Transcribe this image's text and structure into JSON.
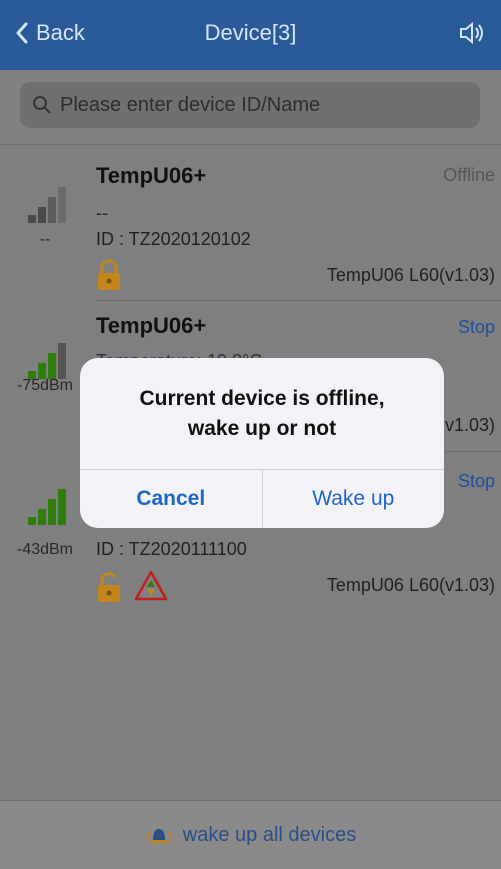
{
  "nav": {
    "back_label": "Back",
    "title": "Device[3]",
    "speaker_icon": "speaker-icon"
  },
  "search": {
    "placeholder": "Please enter device ID/Name"
  },
  "devices": [
    {
      "name": "TempU06+",
      "status": "Offline",
      "line2": "--",
      "id": "ID : TZ2020120102",
      "signal": "--",
      "version": "TempU06 L60(v1.03)",
      "locked": true
    },
    {
      "name": "TempU06+",
      "status": "Stop",
      "line2": "Temperature: 19.8°C",
      "signal": "-75dBm",
      "version": "v1.03)"
    },
    {
      "name": "",
      "status": "Stop",
      "id": "ID : TZ2020111100",
      "signal": "-43dBm",
      "version": "TempU06 L60(v1.03)",
      "locked": false,
      "warning": true
    }
  ],
  "dialog": {
    "message_line1": "Current device is offline,",
    "message_line2": "wake up or not",
    "cancel": "Cancel",
    "wake": "Wake up"
  },
  "bottom": {
    "wake_all": "wake up all devices"
  },
  "colors": {
    "accent": "#1f66c6",
    "online": "#2e7d0d",
    "lock": "#c1871d",
    "warn": "#c0201d"
  }
}
